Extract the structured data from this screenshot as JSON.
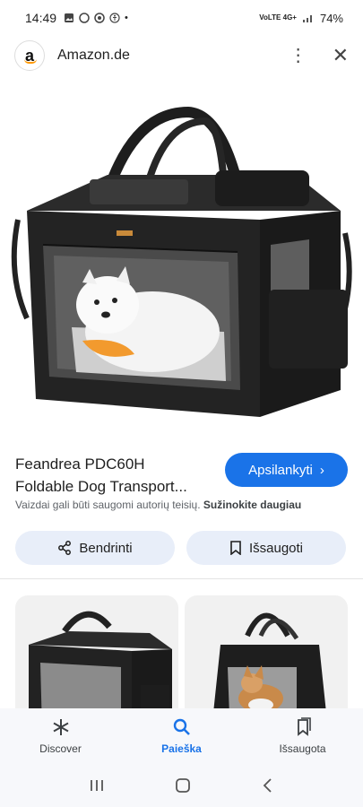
{
  "status_bar": {
    "time": "14:49",
    "network": "VoLTE 4G+",
    "battery": "74%"
  },
  "header": {
    "site_name": "Amazon.de",
    "logo_letter": "a"
  },
  "product": {
    "title_line1": "Feandrea PDC60H",
    "title_line2": "Foldable Dog Transport...",
    "visit_label": "Apsilankyti",
    "copyright_text": "Vaizdai gali būti saugomi autorių teisių.",
    "learn_more": "Sužinokite daugiau"
  },
  "actions": {
    "share_label": "Bendrinti",
    "save_label": "Išsaugoti"
  },
  "bottom_nav": {
    "items": [
      {
        "label": "Discover",
        "icon": "asterisk-icon"
      },
      {
        "label": "Paieška",
        "icon": "search-icon"
      },
      {
        "label": "Išsaugota",
        "icon": "collections-icon"
      }
    ]
  },
  "colors": {
    "accent": "#1a73e8",
    "pill_bg": "#e8eef9"
  }
}
